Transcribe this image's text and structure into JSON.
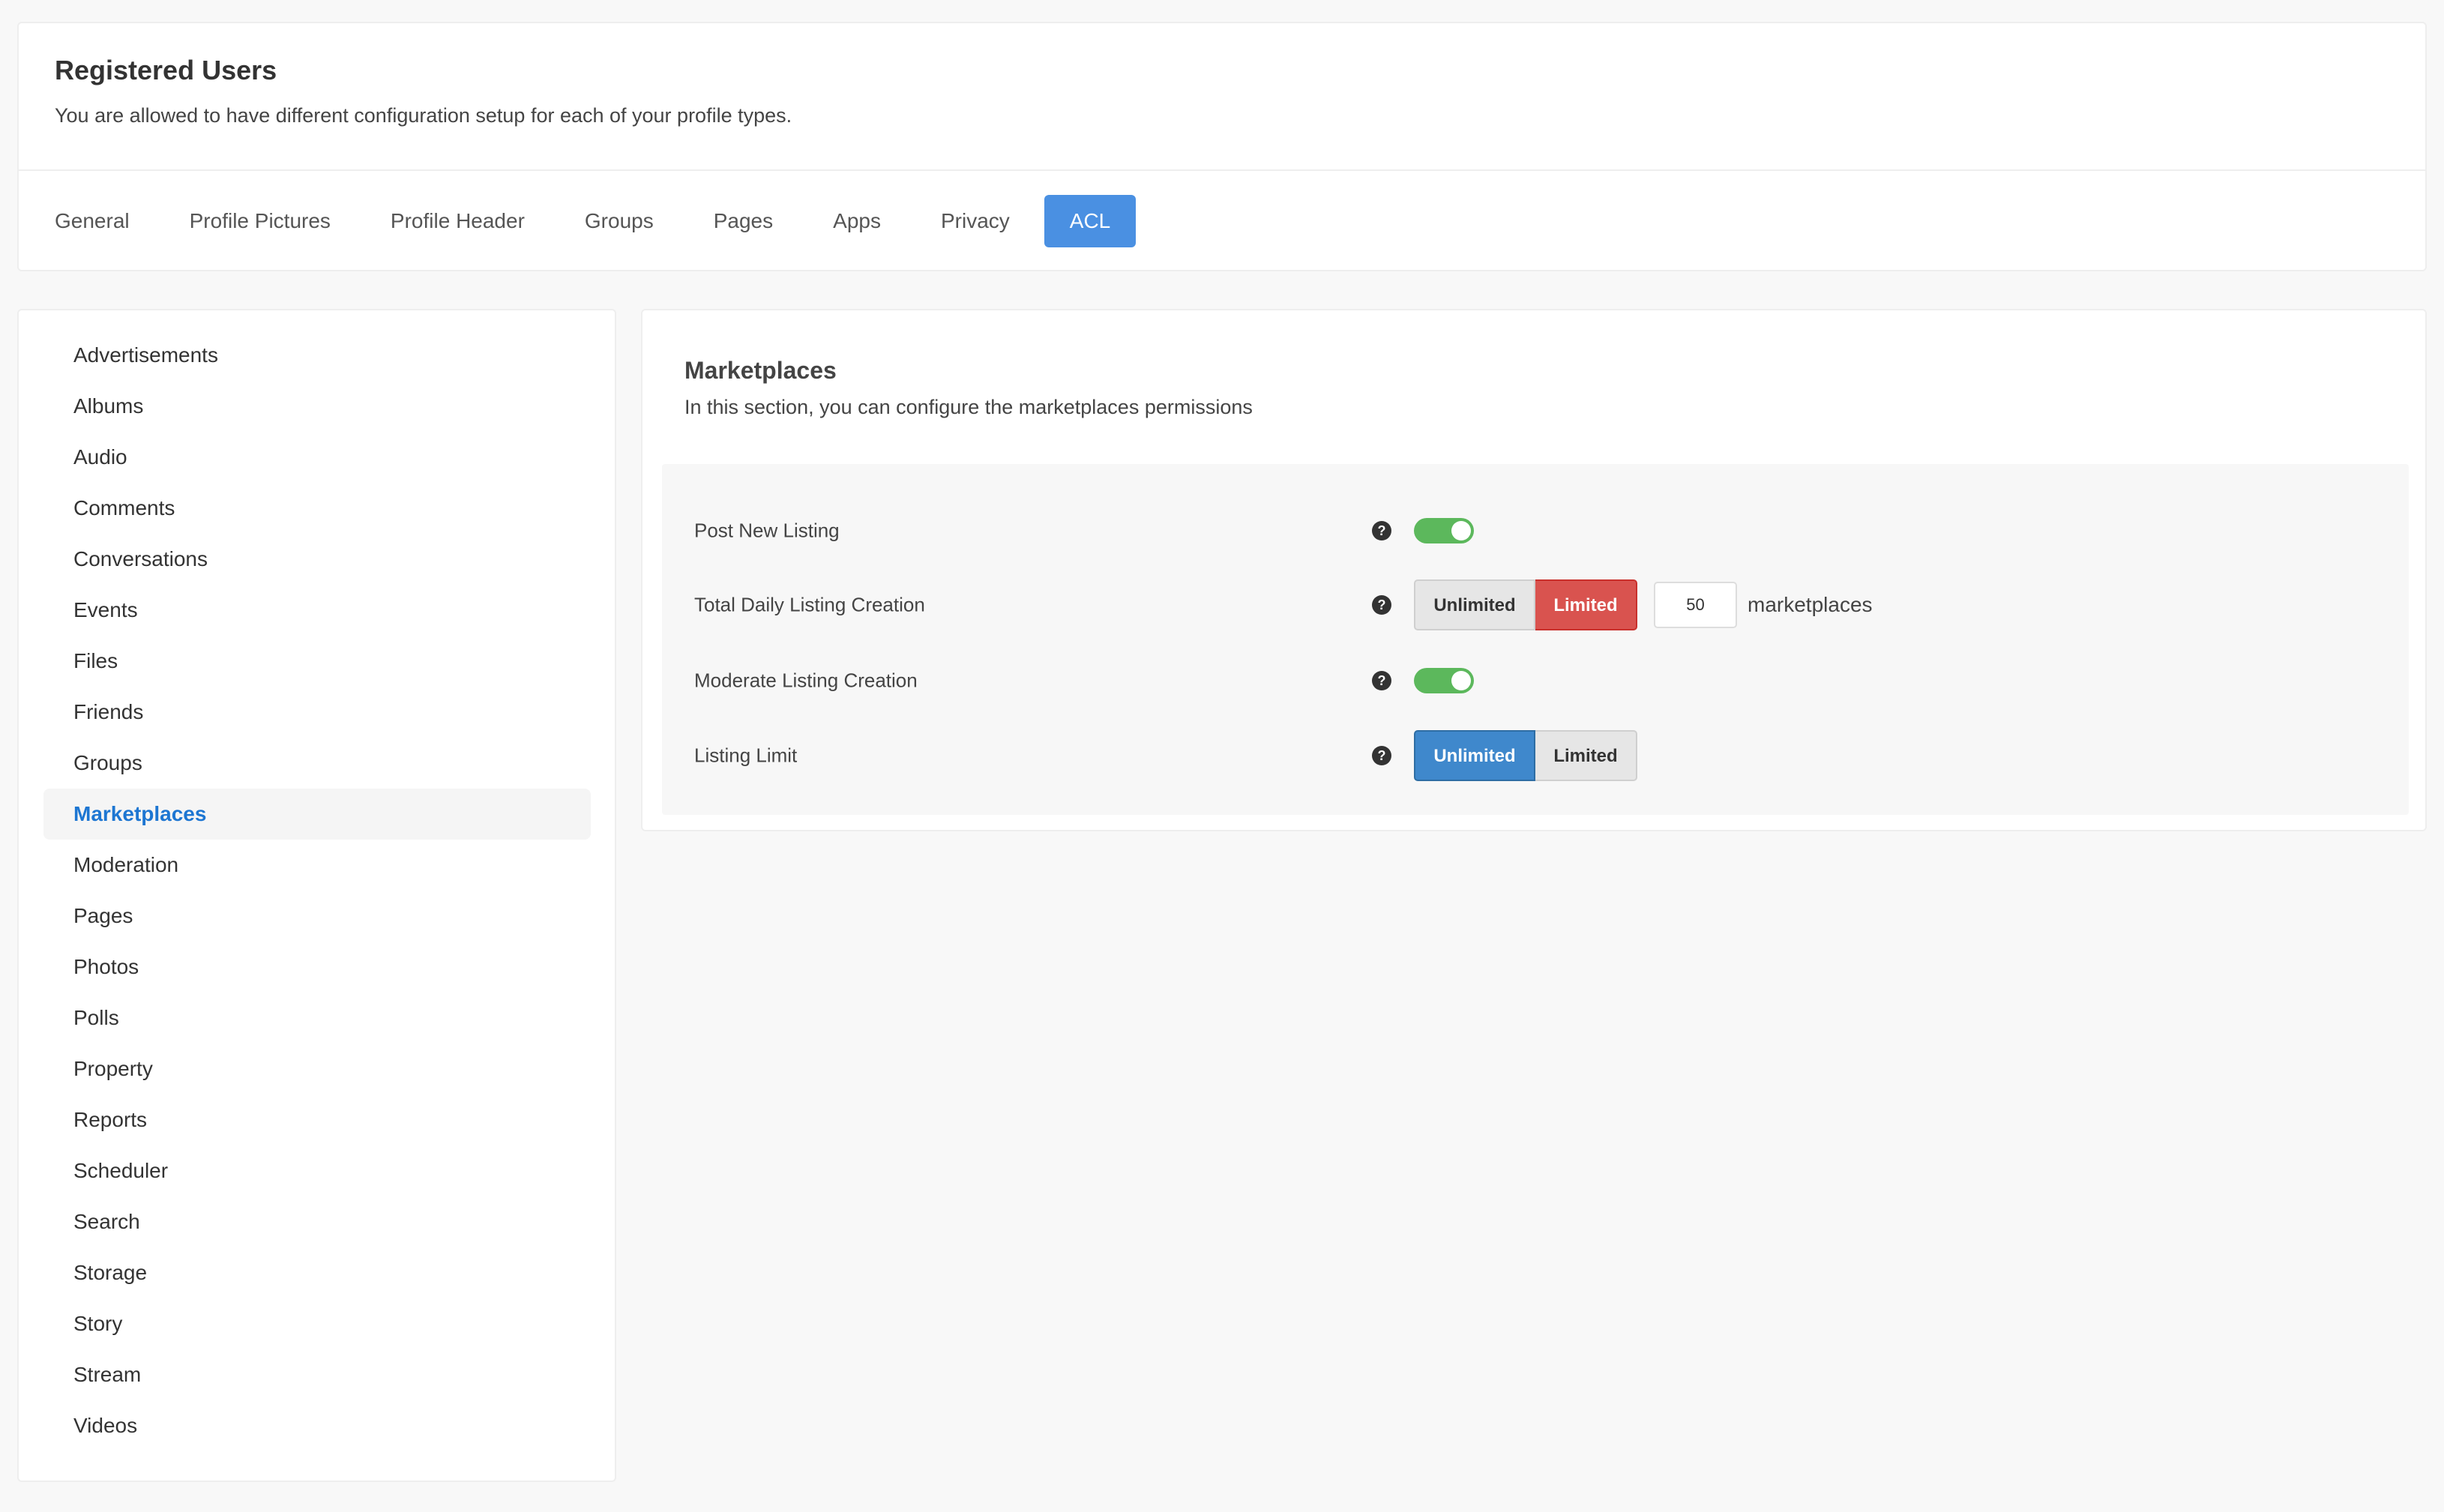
{
  "header": {
    "title": "Registered Users",
    "subtitle": "You are allowed to have different configuration setup for each of your profile types."
  },
  "tabs": [
    {
      "label": "General",
      "active": false
    },
    {
      "label": "Profile Pictures",
      "active": false
    },
    {
      "label": "Profile Header",
      "active": false
    },
    {
      "label": "Groups",
      "active": false
    },
    {
      "label": "Pages",
      "active": false
    },
    {
      "label": "Apps",
      "active": false
    },
    {
      "label": "Privacy",
      "active": false
    },
    {
      "label": "ACL",
      "active": true
    }
  ],
  "sidebar": {
    "active_item": "Marketplaces",
    "items": [
      {
        "label": "Advertisements"
      },
      {
        "label": "Albums"
      },
      {
        "label": "Audio"
      },
      {
        "label": "Comments"
      },
      {
        "label": "Conversations"
      },
      {
        "label": "Events"
      },
      {
        "label": "Files"
      },
      {
        "label": "Friends"
      },
      {
        "label": "Groups"
      },
      {
        "label": "Marketplaces"
      },
      {
        "label": "Moderation"
      },
      {
        "label": "Pages"
      },
      {
        "label": "Photos"
      },
      {
        "label": "Polls"
      },
      {
        "label": "Property"
      },
      {
        "label": "Reports"
      },
      {
        "label": "Scheduler"
      },
      {
        "label": "Search"
      },
      {
        "label": "Storage"
      },
      {
        "label": "Story"
      },
      {
        "label": "Stream"
      },
      {
        "label": "Videos"
      }
    ]
  },
  "section": {
    "title": "Marketplaces",
    "description": "In this section, you can configure the marketplaces permissions"
  },
  "settings": {
    "post_new_listing": {
      "label": "Post New Listing",
      "enabled": true
    },
    "total_daily_listing_creation": {
      "label": "Total Daily Listing Creation",
      "unlimited_label": "Unlimited",
      "limited_label": "Limited",
      "selected": "Limited",
      "value": "50",
      "unit": "marketplaces"
    },
    "moderate_listing_creation": {
      "label": "Moderate Listing Creation",
      "enabled": true
    },
    "listing_limit": {
      "label": "Listing Limit",
      "unlimited_label": "Unlimited",
      "limited_label": "Limited",
      "selected": "Unlimited"
    }
  },
  "icons": {
    "help": "question-circle-icon"
  },
  "colors": {
    "accent_blue": "#4a90e2",
    "active_sidebar_text": "#1d76d2",
    "toggle_on": "#5cb85c",
    "limited_selected": "#d9534f",
    "unlimited_selected": "#3f88cc"
  }
}
